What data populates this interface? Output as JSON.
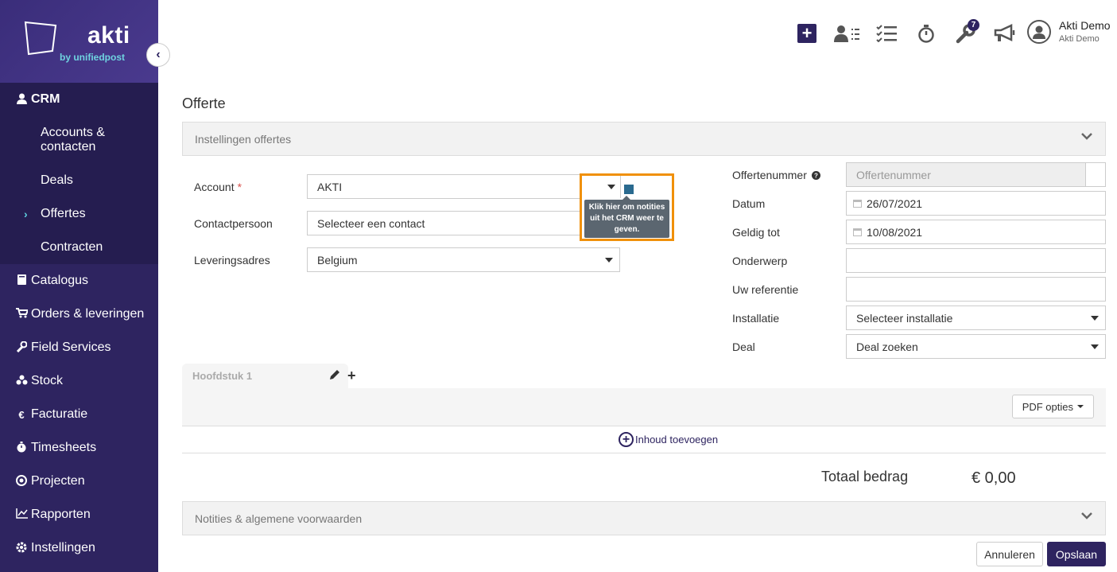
{
  "logo": {
    "brand": "akti",
    "sub": "by unifiedpost"
  },
  "sidebar": {
    "crm": "CRM",
    "crm_items": [
      "Accounts & contacten",
      "Deals",
      "Offertes",
      "Contracten"
    ],
    "items": [
      {
        "label": "Catalogus",
        "icon": "book-icon"
      },
      {
        "label": "Orders & leveringen",
        "icon": "cart-icon"
      },
      {
        "label": "Field Services",
        "icon": "wrench-icon"
      },
      {
        "label": "Stock",
        "icon": "boxes-icon"
      },
      {
        "label": "Facturatie",
        "icon": "euro-icon"
      },
      {
        "label": "Timesheets",
        "icon": "stopwatch-icon"
      },
      {
        "label": "Projecten",
        "icon": "target-icon"
      },
      {
        "label": "Rapporten",
        "icon": "chart-icon"
      },
      {
        "label": "Instellingen",
        "icon": "gear-icon"
      }
    ]
  },
  "topbar": {
    "badge_count": "7",
    "user_name": "Akti Demo",
    "user_company": "Akti Demo"
  },
  "page": {
    "title": "Offerte",
    "settings_panel": "Instellingen offertes",
    "notes_panel": "Notities & algemene voorwaarden"
  },
  "form_left": {
    "account_label": "Account",
    "account_required": "*",
    "account_value": "AKTI",
    "contact_label": "Contactpersoon",
    "contact_value": "Selecteer een contact",
    "address_label": "Leveringsadres",
    "address_value": "Belgium",
    "tooltip": "Klik hier om notities uit het CRM weer te geven."
  },
  "form_right": {
    "number_label": "Offertenummer",
    "number_placeholder": "Offertenummer",
    "date_label": "Datum",
    "date_value": "26/07/2021",
    "valid_label": "Geldig tot",
    "valid_value": "10/08/2021",
    "subject_label": "Onderwerp",
    "reference_label": "Uw referentie",
    "installation_label": "Installatie",
    "installation_value": "Selecteer installatie",
    "deal_label": "Deal",
    "deal_value": "Deal zoeken"
  },
  "chapter": {
    "title": "Hoofdstuk 1",
    "pdf_options": "PDF opties",
    "add_content": "Inhoud toevoegen"
  },
  "totals": {
    "label": "Totaal bedrag",
    "value": "€ 0,00"
  },
  "actions": {
    "cancel": "Annuleren",
    "save": "Opslaan"
  },
  "colors": {
    "brand": "#2e2460",
    "accent": "#5ed0df",
    "highlight": "#f0900a"
  }
}
